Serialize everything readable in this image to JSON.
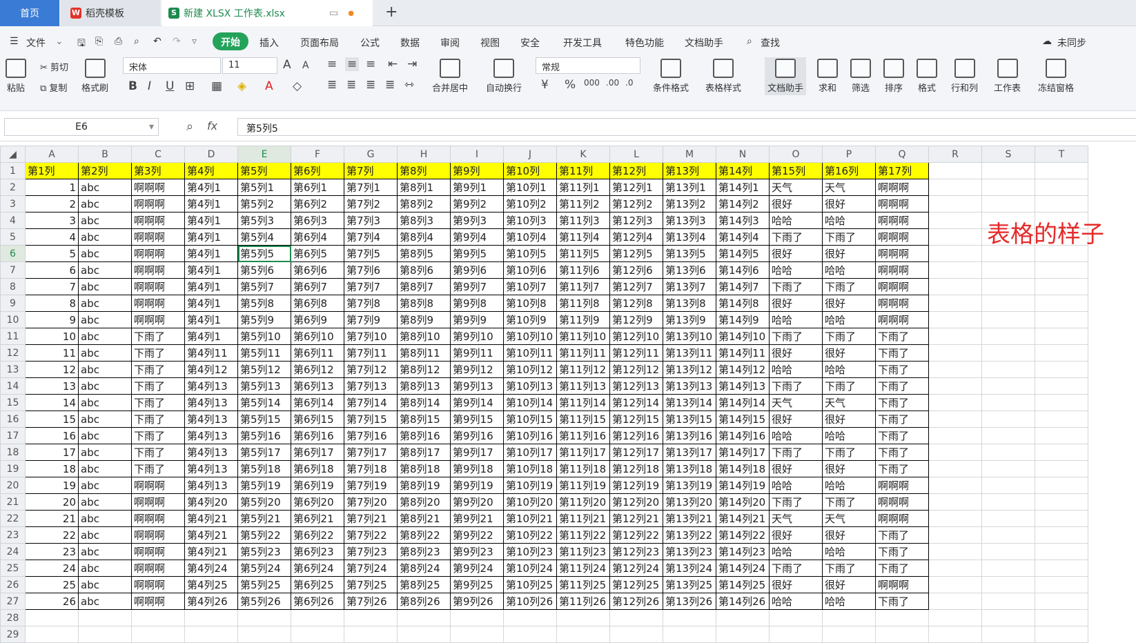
{
  "tabs": {
    "home": "首页",
    "template": "稻壳模板",
    "file": "新建 XLSX 工作表.xlsx"
  },
  "menu": {
    "file": "文件",
    "items": [
      "开始",
      "插入",
      "页面布局",
      "公式",
      "数据",
      "审阅",
      "视图",
      "安全",
      "开发工具",
      "特色功能",
      "文档助手"
    ],
    "search": "查找",
    "sync": "未同步"
  },
  "ribbon": {
    "paste": "粘贴",
    "cut": "剪切",
    "copy": "复制",
    "format_painter": "格式刷",
    "font": "宋体",
    "font_size": "11",
    "merge": "合并居中",
    "wrap": "自动换行",
    "number_format": "常规",
    "cond_format": "条件格式",
    "table_style": "表格样式",
    "doc_helper": "文档助手",
    "sum": "求和",
    "filter": "筛选",
    "sort": "排序",
    "format": "格式",
    "row_col": "行和列",
    "sheet": "工作表",
    "freeze": "冻结窗格"
  },
  "formula_bar": {
    "cell": "E6",
    "fx": "fx",
    "content": "第5列5"
  },
  "annotation": "表格的样子",
  "columns": [
    "A",
    "B",
    "C",
    "D",
    "E",
    "F",
    "G",
    "H",
    "I",
    "J",
    "K",
    "L",
    "M",
    "N",
    "O",
    "P",
    "Q",
    "R",
    "S",
    "T"
  ],
  "header": [
    "第1列",
    "第2列",
    "第3列",
    "第4列",
    "第5列",
    "第6列",
    "第7列",
    "第8列",
    "第9列",
    "第10列",
    "第11列",
    "第12列",
    "第13列",
    "第14列",
    "第15列",
    "第16列",
    "第17列"
  ],
  "rows": [
    [
      "1",
      "abc",
      "啊啊啊",
      "第4列1",
      "第5列1",
      "第6列1",
      "第7列1",
      "第8列1",
      "第9列1",
      "第10列1",
      "第11列1",
      "第12列1",
      "第13列1",
      "第14列1",
      "天气",
      "天气",
      "啊啊啊"
    ],
    [
      "2",
      "abc",
      "啊啊啊",
      "第4列1",
      "第5列2",
      "第6列2",
      "第7列2",
      "第8列2",
      "第9列2",
      "第10列2",
      "第11列2",
      "第12列2",
      "第13列2",
      "第14列2",
      "很好",
      "很好",
      "啊啊啊"
    ],
    [
      "3",
      "abc",
      "啊啊啊",
      "第4列1",
      "第5列3",
      "第6列3",
      "第7列3",
      "第8列3",
      "第9列3",
      "第10列3",
      "第11列3",
      "第12列3",
      "第13列3",
      "第14列3",
      "哈哈",
      "哈哈",
      "啊啊啊"
    ],
    [
      "4",
      "abc",
      "啊啊啊",
      "第4列1",
      "第5列4",
      "第6列4",
      "第7列4",
      "第8列4",
      "第9列4",
      "第10列4",
      "第11列4",
      "第12列4",
      "第13列4",
      "第14列4",
      "下雨了",
      "下雨了",
      "啊啊啊"
    ],
    [
      "5",
      "abc",
      "啊啊啊",
      "第4列1",
      "第5列5",
      "第6列5",
      "第7列5",
      "第8列5",
      "第9列5",
      "第10列5",
      "第11列5",
      "第12列5",
      "第13列5",
      "第14列5",
      "很好",
      "很好",
      "啊啊啊"
    ],
    [
      "6",
      "abc",
      "啊啊啊",
      "第4列1",
      "第5列6",
      "第6列6",
      "第7列6",
      "第8列6",
      "第9列6",
      "第10列6",
      "第11列6",
      "第12列6",
      "第13列6",
      "第14列6",
      "哈哈",
      "哈哈",
      "啊啊啊"
    ],
    [
      "7",
      "abc",
      "啊啊啊",
      "第4列1",
      "第5列7",
      "第6列7",
      "第7列7",
      "第8列7",
      "第9列7",
      "第10列7",
      "第11列7",
      "第12列7",
      "第13列7",
      "第14列7",
      "下雨了",
      "下雨了",
      "啊啊啊"
    ],
    [
      "8",
      "abc",
      "啊啊啊",
      "第4列1",
      "第5列8",
      "第6列8",
      "第7列8",
      "第8列8",
      "第9列8",
      "第10列8",
      "第11列8",
      "第12列8",
      "第13列8",
      "第14列8",
      "很好",
      "很好",
      "啊啊啊"
    ],
    [
      "9",
      "abc",
      "啊啊啊",
      "第4列1",
      "第5列9",
      "第6列9",
      "第7列9",
      "第8列9",
      "第9列9",
      "第10列9",
      "第11列9",
      "第12列9",
      "第13列9",
      "第14列9",
      "哈哈",
      "哈哈",
      "啊啊啊"
    ],
    [
      "10",
      "abc",
      "下雨了",
      "第4列1",
      "第5列10",
      "第6列10",
      "第7列10",
      "第8列10",
      "第9列10",
      "第10列10",
      "第11列10",
      "第12列10",
      "第13列10",
      "第14列10",
      "下雨了",
      "下雨了",
      "下雨了"
    ],
    [
      "11",
      "abc",
      "下雨了",
      "第4列11",
      "第5列11",
      "第6列11",
      "第7列11",
      "第8列11",
      "第9列11",
      "第10列11",
      "第11列11",
      "第12列11",
      "第13列11",
      "第14列11",
      "很好",
      "很好",
      "下雨了"
    ],
    [
      "12",
      "abc",
      "下雨了",
      "第4列12",
      "第5列12",
      "第6列12",
      "第7列12",
      "第8列12",
      "第9列12",
      "第10列12",
      "第11列12",
      "第12列12",
      "第13列12",
      "第14列12",
      "哈哈",
      "哈哈",
      "下雨了"
    ],
    [
      "13",
      "abc",
      "下雨了",
      "第4列13",
      "第5列13",
      "第6列13",
      "第7列13",
      "第8列13",
      "第9列13",
      "第10列13",
      "第11列13",
      "第12列13",
      "第13列13",
      "第14列13",
      "下雨了",
      "下雨了",
      "下雨了"
    ],
    [
      "14",
      "abc",
      "下雨了",
      "第4列13",
      "第5列14",
      "第6列14",
      "第7列14",
      "第8列14",
      "第9列14",
      "第10列14",
      "第11列14",
      "第12列14",
      "第13列14",
      "第14列14",
      "天气",
      "天气",
      "下雨了"
    ],
    [
      "15",
      "abc",
      "下雨了",
      "第4列13",
      "第5列15",
      "第6列15",
      "第7列15",
      "第8列15",
      "第9列15",
      "第10列15",
      "第11列15",
      "第12列15",
      "第13列15",
      "第14列15",
      "很好",
      "很好",
      "下雨了"
    ],
    [
      "16",
      "abc",
      "下雨了",
      "第4列13",
      "第5列16",
      "第6列16",
      "第7列16",
      "第8列16",
      "第9列16",
      "第10列16",
      "第11列16",
      "第12列16",
      "第13列16",
      "第14列16",
      "哈哈",
      "哈哈",
      "下雨了"
    ],
    [
      "17",
      "abc",
      "下雨了",
      "第4列13",
      "第5列17",
      "第6列17",
      "第7列17",
      "第8列17",
      "第9列17",
      "第10列17",
      "第11列17",
      "第12列17",
      "第13列17",
      "第14列17",
      "下雨了",
      "下雨了",
      "下雨了"
    ],
    [
      "18",
      "abc",
      "下雨了",
      "第4列13",
      "第5列18",
      "第6列18",
      "第7列18",
      "第8列18",
      "第9列18",
      "第10列18",
      "第11列18",
      "第12列18",
      "第13列18",
      "第14列18",
      "很好",
      "很好",
      "下雨了"
    ],
    [
      "19",
      "abc",
      "啊啊啊",
      "第4列13",
      "第5列19",
      "第6列19",
      "第7列19",
      "第8列19",
      "第9列19",
      "第10列19",
      "第11列19",
      "第12列19",
      "第13列19",
      "第14列19",
      "哈哈",
      "哈哈",
      "啊啊啊"
    ],
    [
      "20",
      "abc",
      "啊啊啊",
      "第4列20",
      "第5列20",
      "第6列20",
      "第7列20",
      "第8列20",
      "第9列20",
      "第10列20",
      "第11列20",
      "第12列20",
      "第13列20",
      "第14列20",
      "下雨了",
      "下雨了",
      "啊啊啊"
    ],
    [
      "21",
      "abc",
      "啊啊啊",
      "第4列21",
      "第5列21",
      "第6列21",
      "第7列21",
      "第8列21",
      "第9列21",
      "第10列21",
      "第11列21",
      "第12列21",
      "第13列21",
      "第14列21",
      "天气",
      "天气",
      "啊啊啊"
    ],
    [
      "22",
      "abc",
      "啊啊啊",
      "第4列21",
      "第5列22",
      "第6列22",
      "第7列22",
      "第8列22",
      "第9列22",
      "第10列22",
      "第11列22",
      "第12列22",
      "第13列22",
      "第14列22",
      "很好",
      "很好",
      "下雨了"
    ],
    [
      "23",
      "abc",
      "啊啊啊",
      "第4列21",
      "第5列23",
      "第6列23",
      "第7列23",
      "第8列23",
      "第9列23",
      "第10列23",
      "第11列23",
      "第12列23",
      "第13列23",
      "第14列23",
      "哈哈",
      "哈哈",
      "下雨了"
    ],
    [
      "24",
      "abc",
      "啊啊啊",
      "第4列24",
      "第5列24",
      "第6列24",
      "第7列24",
      "第8列24",
      "第9列24",
      "第10列24",
      "第11列24",
      "第12列24",
      "第13列24",
      "第14列24",
      "下雨了",
      "下雨了",
      "下雨了"
    ],
    [
      "25",
      "abc",
      "啊啊啊",
      "第4列25",
      "第5列25",
      "第6列25",
      "第7列25",
      "第8列25",
      "第9列25",
      "第10列25",
      "第11列25",
      "第12列25",
      "第13列25",
      "第14列25",
      "很好",
      "很好",
      "啊啊啊"
    ],
    [
      "26",
      "abc",
      "啊啊啊",
      "第4列26",
      "第5列26",
      "第6列26",
      "第7列26",
      "第8列26",
      "第9列26",
      "第10列26",
      "第11列26",
      "第12列26",
      "第13列26",
      "第14列26",
      "哈哈",
      "哈哈",
      "下雨了"
    ]
  ],
  "total_rows": 29,
  "active_cell": {
    "col": "E",
    "row": 6
  },
  "colors": {
    "header_fill": "#ffff00",
    "accent": "#24a25a",
    "annotation": "#e52a2a"
  }
}
